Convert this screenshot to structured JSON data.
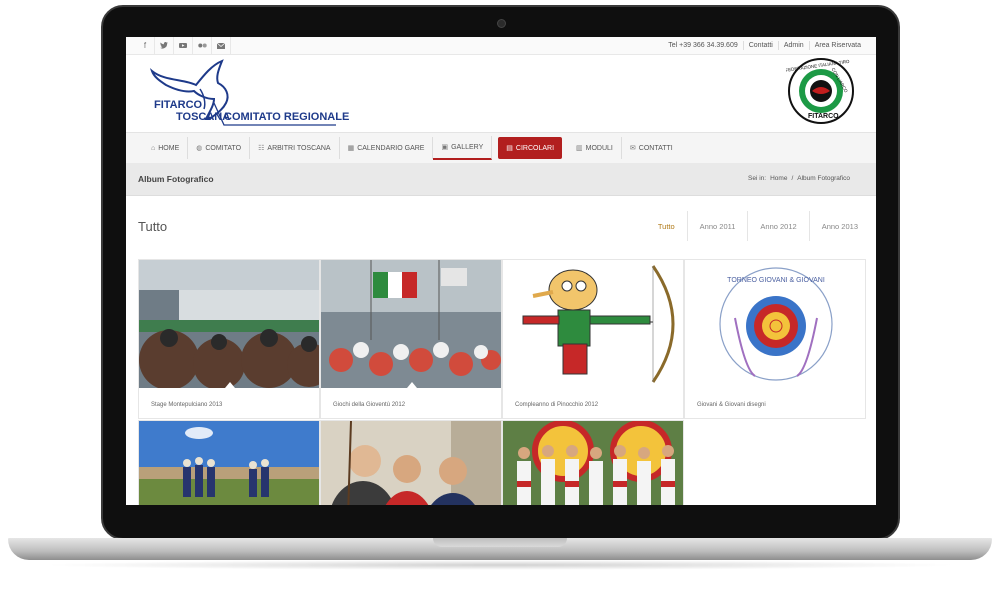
{
  "topbar": {
    "social_icons": [
      "facebook-icon",
      "twitter-icon",
      "youtube-icon",
      "flickr-icon",
      "mail-icon"
    ],
    "phone": "Tel +39 366 34.39.609",
    "links": [
      "Contatti",
      "Admin",
      "Area Riservata"
    ]
  },
  "logo": {
    "line1": "FITARCO",
    "line2": "TOSCANA",
    "line3": "COMITATO REGIONALE",
    "seal_text": "FITARCO",
    "seal_ring_text": "FEDERAZIONE ITALIANA TIRO CON L'ARCO"
  },
  "nav": {
    "items": [
      {
        "label": "HOME",
        "icon": "home-icon"
      },
      {
        "label": "COMITATO",
        "icon": "globe-icon"
      },
      {
        "label": "ARBITRI TOSCANA",
        "icon": "list-icon"
      },
      {
        "label": "CALENDARIO GARE",
        "icon": "calendar-icon"
      },
      {
        "label": "GALLERY",
        "icon": "image-icon"
      },
      {
        "label": "CIRCOLARI",
        "icon": "document-icon"
      },
      {
        "label": "MODULI",
        "icon": "file-icon"
      },
      {
        "label": "CONTATTI",
        "icon": "envelope-icon"
      }
    ],
    "active": "GALLERY",
    "highlight_color": "#b21f1f"
  },
  "titlebar": {
    "title": "Album Fotografico",
    "breadcrumb_prefix": "Sei in:",
    "breadcrumb_home": "Home",
    "breadcrumb_sep": "/",
    "breadcrumb_current": "Album Fotografico"
  },
  "section": {
    "title": "Tutto",
    "filters": [
      "Tutto",
      "Anno 2011",
      "Anno 2012",
      "Anno 2013"
    ]
  },
  "albums": [
    {
      "caption": "Stage Montepulciano 2013"
    },
    {
      "caption": "Giochi della Gioventù 2012"
    },
    {
      "caption": "Compleanno di Pinocchio 2012"
    },
    {
      "caption": "Giovani & Giovani disegni"
    },
    {
      "caption": ""
    },
    {
      "caption": ""
    },
    {
      "caption": ""
    }
  ],
  "drawing_text": "TORNEO GIOVANI & GIOVANI"
}
